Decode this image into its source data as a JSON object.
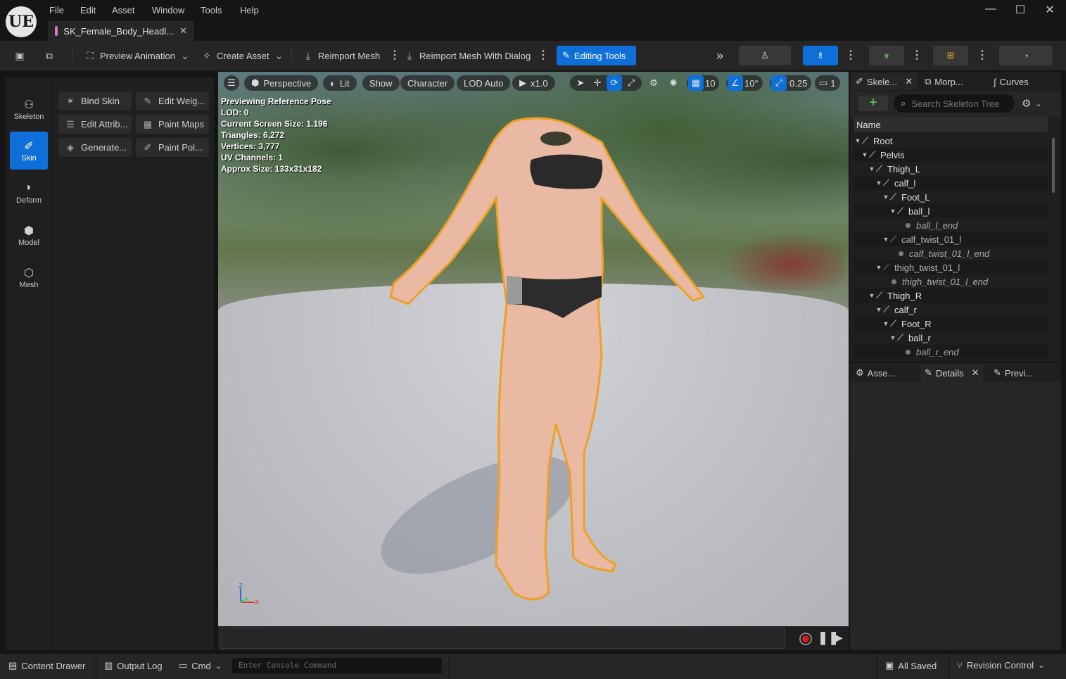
{
  "app": {
    "logo": "UE",
    "menu": [
      "File",
      "Edit",
      "Asset",
      "Window",
      "Tools",
      "Help"
    ],
    "document_tab": "SK_Female_Body_Headl...",
    "window_controls": [
      "minimize-icon",
      "maximize-icon",
      "close-icon"
    ]
  },
  "toolbar": {
    "preview_animation": "Preview Animation",
    "create_asset": "Create Asset",
    "reimport_mesh": "Reimport Mesh",
    "reimport_dialog": "Reimport Mesh With Dialog",
    "editing_tools": "Editing Tools",
    "accent": "#0e6fd8"
  },
  "modes": [
    {
      "label": "Skeleton",
      "icon": "skeleton-icon"
    },
    {
      "label": "Skin",
      "icon": "skin-brush-icon",
      "active": true
    },
    {
      "label": "Deform",
      "icon": "deform-icon"
    },
    {
      "label": "Model",
      "icon": "model-icon"
    },
    {
      "label": "Mesh",
      "icon": "mesh-icon"
    }
  ],
  "tools": [
    {
      "label": "Bind Skin",
      "icon": "bind-skin-icon"
    },
    {
      "label": "Edit Weig...",
      "icon": "edit-weights-icon"
    },
    {
      "label": "Edit Attrib...",
      "icon": "edit-attributes-icon"
    },
    {
      "label": "Paint Maps",
      "icon": "paint-maps-icon"
    },
    {
      "label": "Generate...",
      "icon": "generate-icon"
    },
    {
      "label": "Paint Pol...",
      "icon": "paint-polygroups-icon"
    }
  ],
  "viewport": {
    "perspective": "Perspective",
    "lit": "Lit",
    "show": "Show",
    "character": "Character",
    "lod": "LOD Auto",
    "speed": "x1.0",
    "grid_snap": "10",
    "rotation_snap": "10°",
    "scale_snap": "0.25",
    "camera_speed": "1",
    "stats": [
      "Previewing Reference Pose",
      "LOD: 0",
      "Current Screen Size: 1.196",
      "Triangles: 6,272",
      "Vertices: 3,777",
      "UV Channels: 1",
      "Approx Size: 133x31x182"
    ],
    "axis_z": "Z",
    "axis_x": "X"
  },
  "right_panel": {
    "tabs": [
      "Skele...",
      "Morp...",
      "Curves"
    ],
    "search_placeholder": "Search Skeleton Tree",
    "column_header": "Name",
    "tree": [
      {
        "name": "Root",
        "kind": "bone"
      },
      {
        "name": "Pelvis",
        "kind": "bone"
      },
      {
        "name": "Thigh_L",
        "kind": "bone"
      },
      {
        "name": "calf_l",
        "kind": "bone"
      },
      {
        "name": "Foot_L",
        "kind": "bone"
      },
      {
        "name": "ball_l",
        "kind": "bone"
      },
      {
        "name": "ball_l_end",
        "kind": "socket"
      },
      {
        "name": "calf_twist_01_l",
        "kind": "virtual"
      },
      {
        "name": "calf_twist_01_l_end",
        "kind": "socket"
      },
      {
        "name": "thigh_twist_01_l",
        "kind": "virtual"
      },
      {
        "name": "thigh_twist_01_l_end",
        "kind": "socket"
      },
      {
        "name": "Thigh_R",
        "kind": "bone"
      },
      {
        "name": "calf_r",
        "kind": "bone"
      },
      {
        "name": "Foot_R",
        "kind": "bone"
      },
      {
        "name": "ball_r",
        "kind": "bone"
      },
      {
        "name": "ball_r_end",
        "kind": "socket"
      }
    ],
    "lower_tabs": [
      "Asse...",
      "Details",
      "Previ..."
    ]
  },
  "statusbar": {
    "content_drawer": "Content Drawer",
    "output_log": "Output Log",
    "cmd": "Cmd",
    "console_placeholder": "Enter Console Command",
    "all_saved": "All Saved",
    "revision_control": "Revision Control"
  }
}
